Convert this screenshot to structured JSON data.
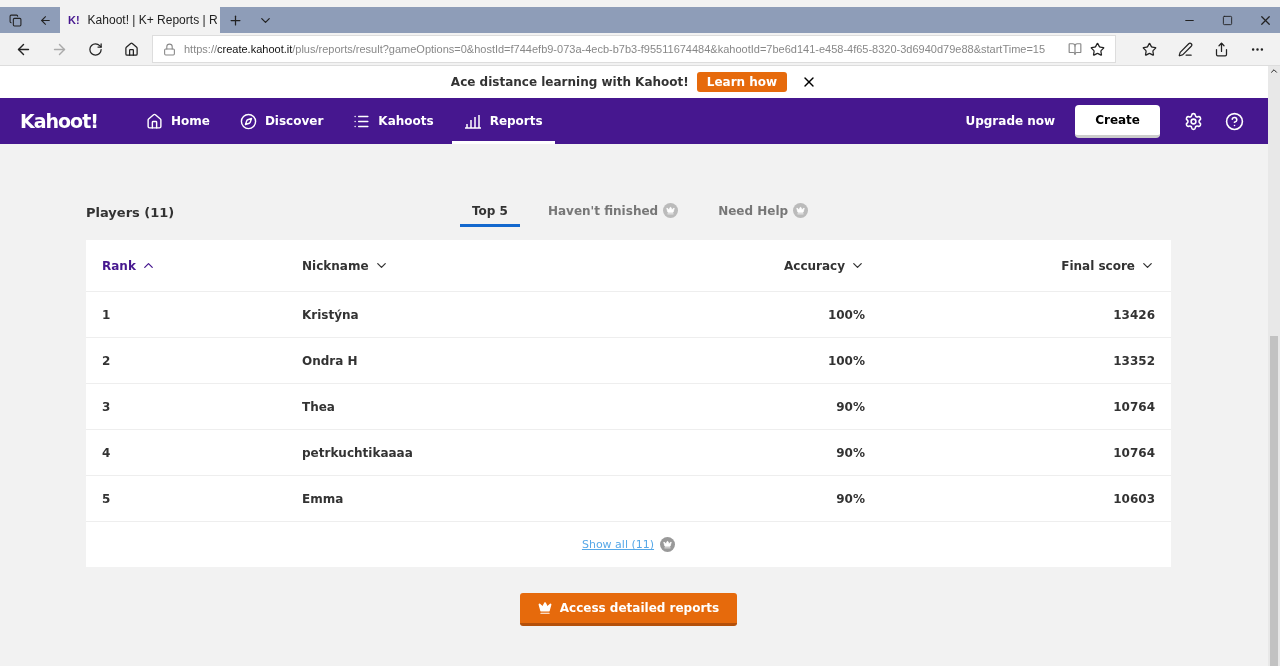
{
  "browser": {
    "favicon": "K!",
    "tab_title": "Kahoot! | K+ Reports | R",
    "url_scheme": "https://",
    "url_host": "create.kahoot.it",
    "url_rest": "/plus/reports/result?gameOptions=0&hostId=f744efb9-073a-4ecb-b7b3-f95511674484&kahootId=7be6d141-e458-4f65-8320-3d6940d79e88&startTime=15"
  },
  "banner": {
    "text": "Ace distance learning with Kahoot!",
    "button": "Learn how"
  },
  "nav": {
    "logo": "Kahoot!",
    "items": [
      {
        "label": "Home",
        "selected": false
      },
      {
        "label": "Discover",
        "selected": false
      },
      {
        "label": "Kahoots",
        "selected": false
      },
      {
        "label": "Reports",
        "selected": true
      }
    ],
    "upgrade": "Upgrade now",
    "create": "Create"
  },
  "players_title": "Players (11)",
  "tabs": [
    {
      "label": "Top 5",
      "selected": true,
      "locked": false
    },
    {
      "label": "Haven't finished",
      "selected": false,
      "locked": true
    },
    {
      "label": "Need Help",
      "selected": false,
      "locked": true
    }
  ],
  "table": {
    "columns": [
      {
        "label": "Rank",
        "sorted": true
      },
      {
        "label": "Nickname",
        "sorted": false
      },
      {
        "label": "Accuracy",
        "sorted": false
      },
      {
        "label": "Final score",
        "sorted": false
      }
    ],
    "rows": [
      [
        "1",
        "Kristýna",
        "100%",
        "13426"
      ],
      [
        "2",
        "Ondra H",
        "100%",
        "13352"
      ],
      [
        "3",
        "Thea",
        "90%",
        "10764"
      ],
      [
        "4",
        "petrkuchtikaaaa",
        "90%",
        "10764"
      ],
      [
        "5",
        "Emma",
        "90%",
        "10603"
      ]
    ],
    "show_all": "Show all (11)"
  },
  "detail_button": "Access detailed reports"
}
